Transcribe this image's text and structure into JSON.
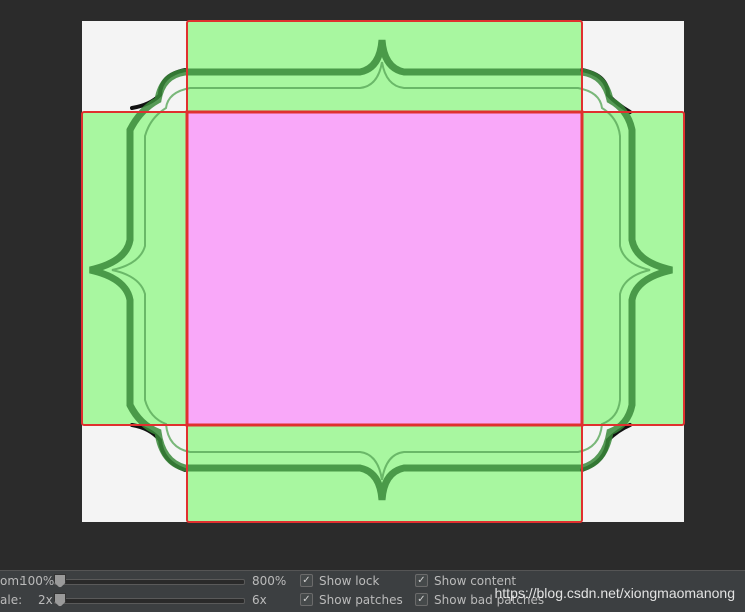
{
  "editor": {
    "zoom_label": "om:",
    "zoom_value": "100%",
    "zoom_max": "800%",
    "patch_scale_label": "ale:",
    "patch_scale_value": "2x",
    "patch_scale_max": "6x",
    "checkboxes": {
      "show_lock": "Show lock",
      "show_patches": "Show patches",
      "show_content": "Show content",
      "show_bad_patches": "Show bad patches"
    },
    "check_glyph": "✓"
  },
  "watermark": "https://blog.csdn.net/xiongmaomanong",
  "colors": {
    "background": "#2b2b2b",
    "panel": "#3c3f41",
    "patch_green": "#a8f7a0",
    "content_pink": "#f9a8f9",
    "border_red": "#e0302f",
    "frame_green": "#3a8a3a"
  }
}
